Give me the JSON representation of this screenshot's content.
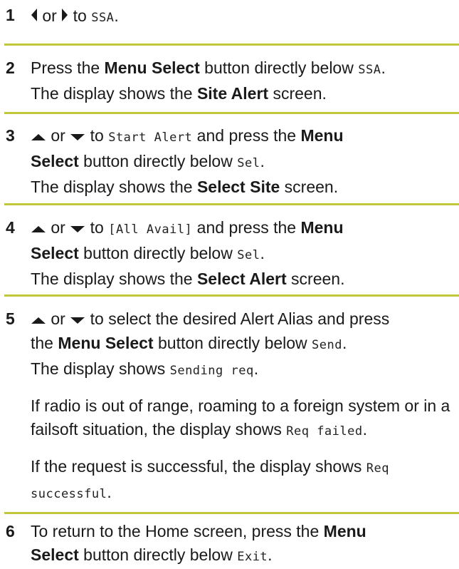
{
  "steps": [
    {
      "num": "1",
      "or": "or",
      "to": "to",
      "ssa": "SSA",
      "dot": "."
    },
    {
      "num": "2",
      "l1a": "Press the ",
      "menu": "Menu Select",
      "l1b": " button directly below ",
      "ssa": "SSA",
      "dot": ".",
      "l2a": "The display shows the ",
      "site_alert": "Site Alert",
      "l2b": " screen."
    },
    {
      "num": "3",
      "or": "or",
      "to": "to",
      "start_alert": "Start Alert",
      "and_press": " and press the ",
      "menu": "Menu",
      "select": "Select",
      "below": " button directly below ",
      "sel": "Sel",
      "dot": ".",
      "l3a": "The display shows the ",
      "select_site": "Select Site",
      "l3b": " screen."
    },
    {
      "num": "4",
      "or": "or",
      "to": "to",
      "all_avail": "[All Avail]",
      "and_press": " and press the ",
      "menu": "Menu",
      "select": "Select",
      "below": " button directly below ",
      "sel": "Sel",
      "dot": ".",
      "l3a": "The display shows the ",
      "select_alert": "Select Alert",
      "l3b": " screen."
    },
    {
      "num": "5",
      "or": "or",
      "to_select": "to select the desired Alert Alias and press",
      "the": "the ",
      "menu": "Menu Select",
      "below": " button directly below ",
      "send": "Send",
      "dot": ".",
      "shows": "The display shows ",
      "sending": "Sending req",
      "dot2": ".",
      "p1": "If radio is out of range, roaming to a foreign system or in a failsoft situation, the display shows ",
      "req_failed": "Req failed",
      "dot3": ".",
      "p2": "If the request is successful, the display shows ",
      "req_success": "Req successful",
      "dot4": "."
    },
    {
      "num": "6",
      "l1": "To return to the Home screen, press the ",
      "menu": "Menu",
      "select": "Select",
      "below": " button directly below ",
      "exit": "Exit",
      "dot": "."
    }
  ],
  "colors": {
    "rule": "#c2c63a",
    "text": "#1a1a1a"
  },
  "icons": [
    "left-arrow-icon",
    "right-arrow-icon",
    "up-arrow-icon",
    "down-arrow-icon"
  ]
}
